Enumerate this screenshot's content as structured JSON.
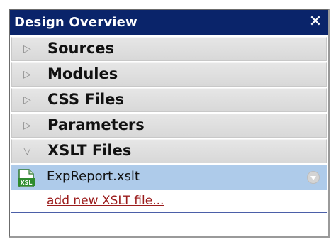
{
  "panel": {
    "title": "Design Overview",
    "close_label": "✕"
  },
  "sections": [
    {
      "label": "Sources",
      "expanded": false
    },
    {
      "label": "Modules",
      "expanded": false
    },
    {
      "label": "CSS Files",
      "expanded": false
    },
    {
      "label": "Parameters",
      "expanded": false
    },
    {
      "label": "XSLT Files",
      "expanded": true
    }
  ],
  "xslt_files": {
    "items": [
      {
        "name": "ExpReport.xslt",
        "icon": "xsl-file-icon",
        "icon_text": "XSL"
      }
    ],
    "add_link": "add new XSLT file..."
  },
  "colors": {
    "title_bar": "#0a246a",
    "selected_row": "#aecbea",
    "link": "#9b1b1b"
  }
}
